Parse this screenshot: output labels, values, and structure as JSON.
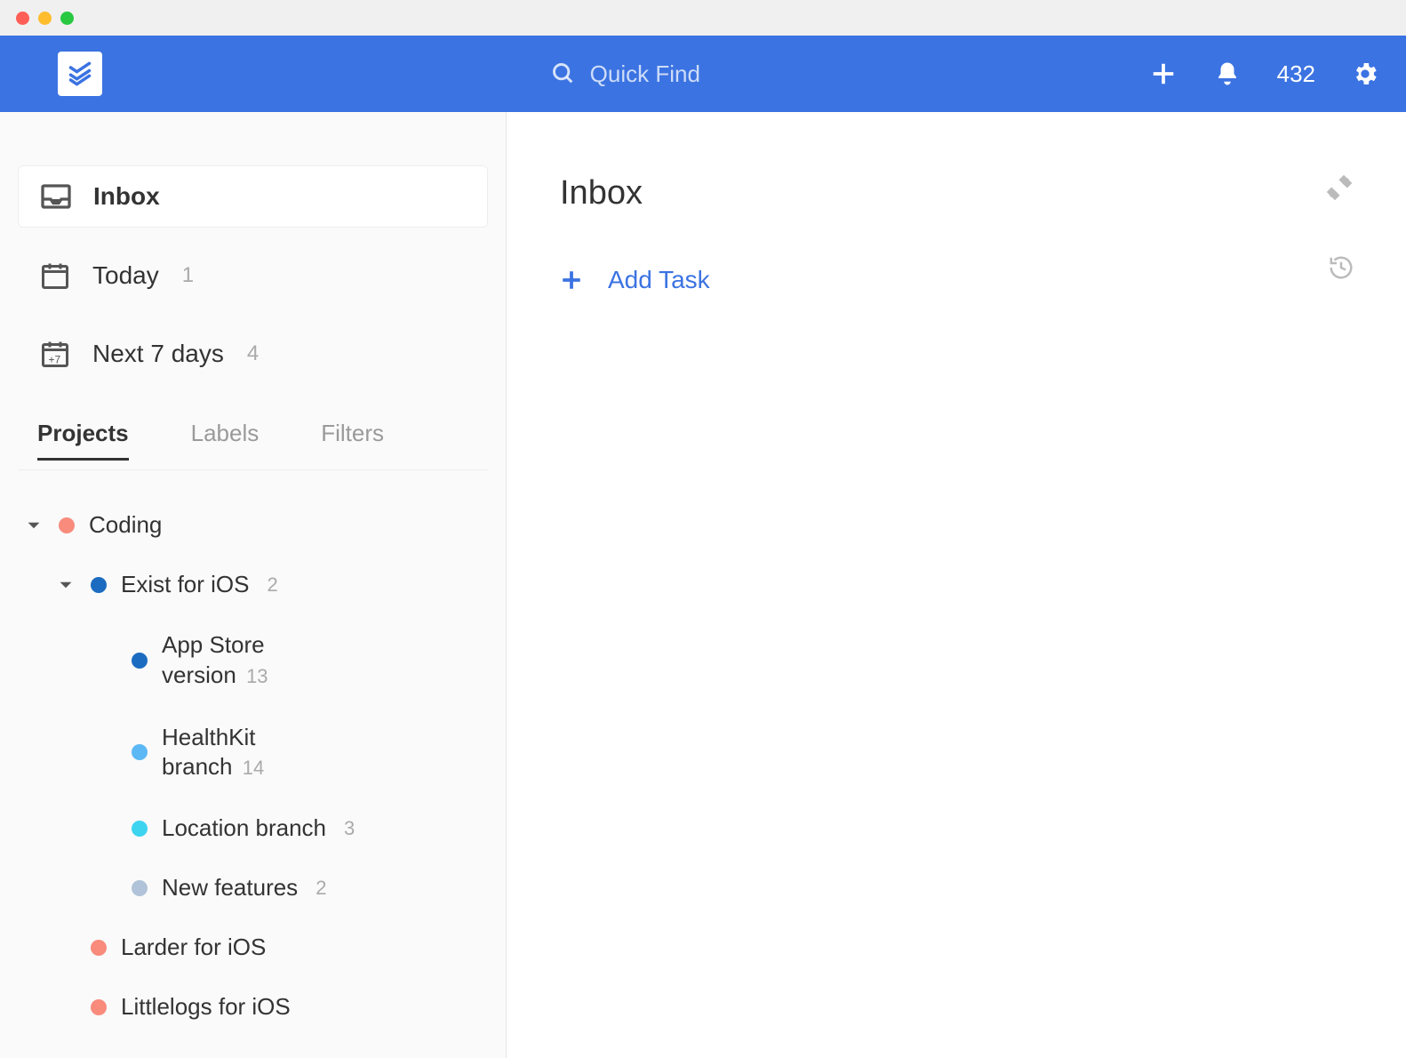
{
  "topbar": {
    "search_placeholder": "Quick Find",
    "notification_count": "432"
  },
  "sidebar": {
    "nav": [
      {
        "label": "Inbox",
        "count": ""
      },
      {
        "label": "Today",
        "count": "1"
      },
      {
        "label": "Next 7 days",
        "count": "4"
      }
    ],
    "tabs": {
      "projects": "Projects",
      "labels": "Labels",
      "filters": "Filters"
    },
    "projects": [
      {
        "name": "Coding",
        "color": "#f88b7c",
        "count": "",
        "level": 0,
        "expandable": true
      },
      {
        "name": "Exist for iOS",
        "color": "#1b6cc0",
        "count": "2",
        "level": 1,
        "expandable": true
      },
      {
        "name": "App Store version",
        "color": "#1b6cc0",
        "count": "13",
        "level": 2,
        "expandable": false,
        "multiline": true,
        "line1": "App Store",
        "line2": "version"
      },
      {
        "name": "HealthKit branch",
        "color": "#5cb8f5",
        "count": "14",
        "level": 2,
        "expandable": false,
        "multiline": true,
        "line1": "HealthKit",
        "line2": "branch"
      },
      {
        "name": "Location branch",
        "color": "#3dd4f0",
        "count": "3",
        "level": 2,
        "expandable": false
      },
      {
        "name": "New features",
        "color": "#b0c3d8",
        "count": "2",
        "level": 2,
        "expandable": false
      },
      {
        "name": "Larder for iOS",
        "color": "#f88b7c",
        "count": "",
        "level": 1,
        "expandable": false
      },
      {
        "name": "Littlelogs for iOS",
        "color": "#f88b7c",
        "count": "",
        "level": 1,
        "expandable": false
      }
    ]
  },
  "content": {
    "title": "Inbox",
    "add_task": "Add Task"
  }
}
